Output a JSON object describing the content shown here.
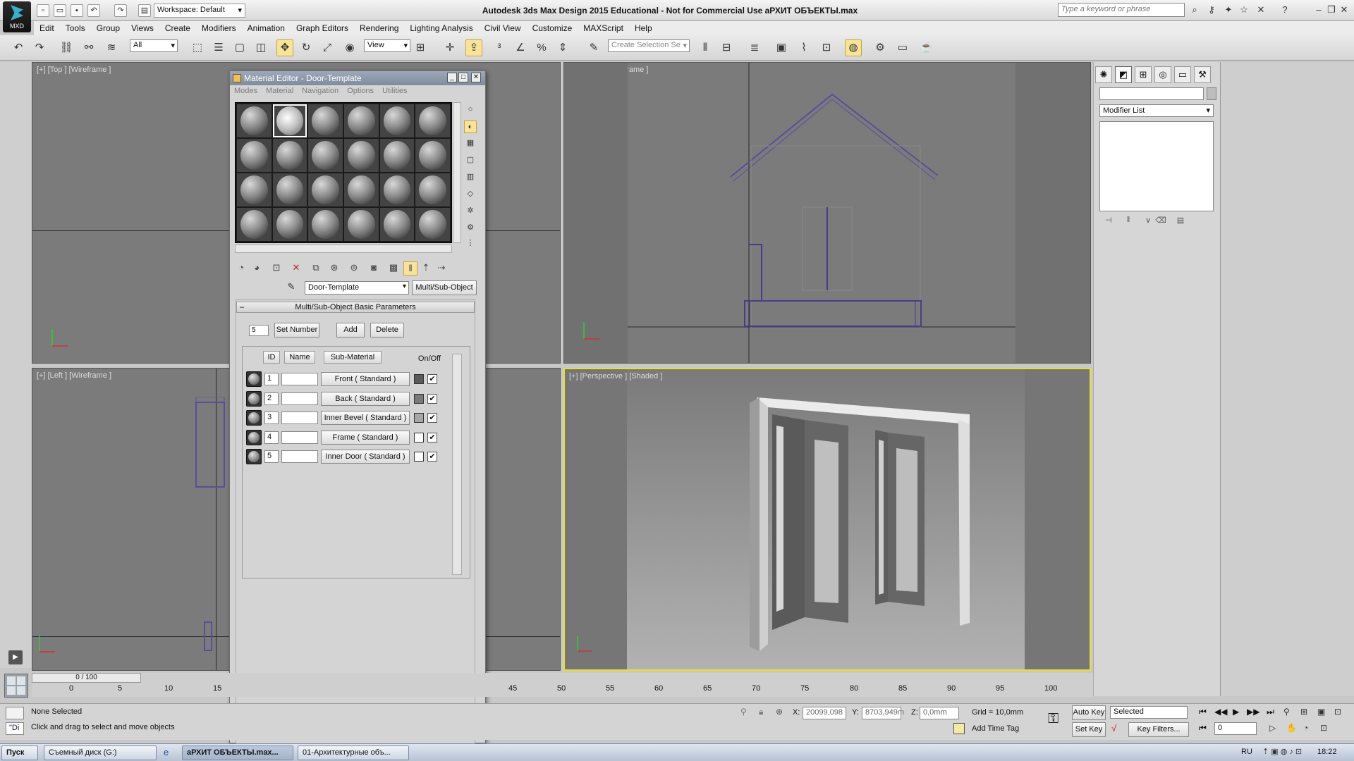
{
  "app": {
    "logo_label": "MXD",
    "title": "Autodesk 3ds Max Design 2015  Educational - Not for Commercial Use   аРХИТ ОБЪЕКТЫ.max",
    "workspace": "Workspace: Default",
    "search_placeholder": "Type a keyword or phrase"
  },
  "menu": [
    "Edit",
    "Tools",
    "Group",
    "Views",
    "Create",
    "Modifiers",
    "Animation",
    "Graph Editors",
    "Rendering",
    "Lighting Analysis",
    "Civil View",
    "Customize",
    "MAXScript",
    "Help"
  ],
  "toolbar": {
    "filter_value": "All",
    "ref_coord": "View",
    "selection_set_placeholder": "Create Selection Se"
  },
  "viewports": {
    "top": "[+] [Top ] [Wireframe ]",
    "front": "[+] [Front ] [Wireframe ]",
    "left": "[+] [Left ] [Wireframe ]",
    "perspective": "[+] [Perspective ] [Shaded ]"
  },
  "material_editor": {
    "title": "Material Editor - Door-Template",
    "menu": [
      "Modes",
      "Material",
      "Navigation",
      "Options",
      "Utilities"
    ],
    "material_name": "Door-Template",
    "material_type": "Multi/Sub-Object",
    "rollout_title": "Multi/Sub-Object Basic Parameters",
    "set_number_value": "5",
    "buttons": {
      "set_number": "Set Number",
      "add": "Add",
      "delete": "Delete"
    },
    "headers": {
      "id": "ID",
      "name": "Name",
      "sub_material": "Sub-Material",
      "on_off": "On/Off"
    },
    "rows": [
      {
        "id": "1",
        "sub": "Front  ( Standard )",
        "color": "#5a5a5a"
      },
      {
        "id": "2",
        "sub": "Back  ( Standard )",
        "color": "#7a7a7a"
      },
      {
        "id": "3",
        "sub": "Inner Bevel  ( Standard )",
        "color": "#a6a6a6"
      },
      {
        "id": "4",
        "sub": "Frame  ( Standard )",
        "color": "#ffffff"
      },
      {
        "id": "5",
        "sub": "Inner Door  ( Standard )",
        "color": "#ffffff"
      }
    ]
  },
  "command_panel": {
    "modifier_list": "Modifier List"
  },
  "timeline": {
    "slider": "0 / 100",
    "ticks": [
      "0",
      "5",
      "10",
      "15",
      "45",
      "50",
      "55",
      "60",
      "65",
      "70",
      "75",
      "80",
      "85",
      "90",
      "95",
      "100"
    ]
  },
  "status": {
    "selection": "None Selected",
    "prompt": "Click and drag to select and move objects",
    "x_label": "X:",
    "x_value": "20099,098",
    "y_label": "Y:",
    "y_value": "8703,949m",
    "z_label": "Z:",
    "z_value": "0,0mm",
    "grid": "Grid = 10,0mm",
    "add_time_tag": "Add Time Tag",
    "auto_key": "Auto Key",
    "set_key": "Set Key",
    "key_mode": "Selected",
    "key_filters": "Key Filters...",
    "frame": "0",
    "mxs": "\"Di"
  },
  "taskbar": {
    "start": "Пуск",
    "items": [
      "Съемный диск (G:)",
      "аРХИТ ОБЪЕКТЫ.max...",
      "01-Архитектурные объ..."
    ],
    "lang": "RU",
    "time": "18:22"
  }
}
